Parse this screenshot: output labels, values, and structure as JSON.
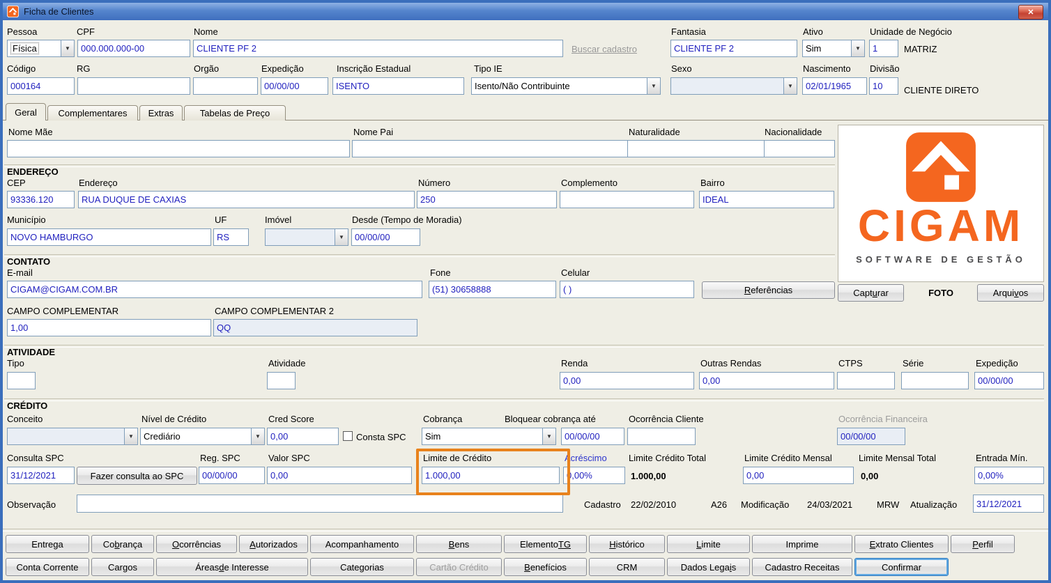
{
  "icons": {
    "close": "✕",
    "dropdown": "▼"
  },
  "window": {
    "title": "Ficha de Clientes"
  },
  "top": {
    "pessoa": {
      "label": "Pessoa",
      "value": "Física"
    },
    "cpf": {
      "label": "CPF",
      "value": "000.000.000-00"
    },
    "nome": {
      "label": "Nome",
      "value": "CLIENTE PF 2"
    },
    "buscar": "Buscar cadastro",
    "fantasia": {
      "label": "Fantasia",
      "value": "CLIENTE PF 2"
    },
    "ativo": {
      "label": "Ativo",
      "value": "Sim"
    },
    "unidade": {
      "label": "Unidade de Negócio",
      "value": "1",
      "desc": "MATRIZ"
    },
    "codigo": {
      "label": "Código",
      "value": "000164"
    },
    "rg": {
      "label": "RG",
      "value": ""
    },
    "orgao": {
      "label": "Orgão",
      "value": ""
    },
    "expedicao": {
      "label": "Expedição",
      "value": "00/00/00"
    },
    "inscricao": {
      "label": "Inscrição Estadual",
      "value": "ISENTO"
    },
    "tipo_ie": {
      "label": "Tipo IE",
      "value": "Isento/Não Contribuinte"
    },
    "sexo": {
      "label": "Sexo",
      "value": ""
    },
    "nascimento": {
      "label": "Nascimento",
      "value": "02/01/1965"
    },
    "divisao": {
      "label": "Divisão",
      "value": "10",
      "desc": "CLIENTE DIRETO"
    }
  },
  "tabs": {
    "geral": "Geral",
    "complementares": "Complementares",
    "extras": "Extras",
    "tabelas": "Tabelas de Preço"
  },
  "geral": {
    "nome_mae": {
      "label": "Nome Mãe",
      "value": ""
    },
    "nome_pai": {
      "label": "Nome Pai",
      "value": ""
    },
    "naturalidade": {
      "label": "Naturalidade",
      "value": ""
    },
    "nacionalidade": {
      "label": "Nacionalidade",
      "value": ""
    }
  },
  "logo": {
    "brand": "CIGAM",
    "tagline": "SOFTWARE DE GESTÃO",
    "capturar": "Capt&urar",
    "foto": "FOTO",
    "arquivos": "Arqui&vos"
  },
  "endereco": {
    "header": "ENDEREÇO",
    "cep": {
      "label": "CEP",
      "value": "93336.120"
    },
    "endereco": {
      "label": "Endereço",
      "value": "RUA DUQUE DE CAXIAS"
    },
    "numero": {
      "label": "Número",
      "value": "250"
    },
    "complemento": {
      "label": "Complemento",
      "value": ""
    },
    "bairro": {
      "label": "Bairro",
      "value": "IDEAL"
    },
    "municipio": {
      "label": "Município",
      "value": "NOVO HAMBURGO"
    },
    "uf": {
      "label": "UF",
      "value": "RS"
    },
    "imovel": {
      "label": "Imóvel",
      "value": ""
    },
    "desde": {
      "label": "Desde (Tempo de Moradia)",
      "value": "00/00/00"
    }
  },
  "contato": {
    "header": "CONTATO",
    "email": {
      "label": "E-mail",
      "value": "CIGAM@CIGAM.COM.BR"
    },
    "fone": {
      "label": "Fone",
      "value": "(51) 30658888"
    },
    "celular": {
      "label": "Celular",
      "value": "( )"
    },
    "referencias": "&Referências",
    "cc1": {
      "label": "CAMPO COMPLEMENTAR",
      "value": "1,00"
    },
    "cc2": {
      "label": "CAMPO COMPLEMENTAR 2",
      "value": "QQ"
    }
  },
  "atividade": {
    "header": "ATIVIDADE",
    "tipo": {
      "label": "Tipo",
      "value": ""
    },
    "atividade": {
      "label": "Atividade",
      "value": ""
    },
    "renda": {
      "label": "Renda",
      "value": "0,00"
    },
    "outras": {
      "label": "Outras Rendas",
      "value": "0,00"
    },
    "ctps": {
      "label": "CTPS",
      "value": ""
    },
    "serie": {
      "label": "Série",
      "value": ""
    },
    "expedicao": {
      "label": "Expedição",
      "value": "00/00/00"
    }
  },
  "credito": {
    "header": "CRÉDITO",
    "conceito": {
      "label": "Conceito",
      "value": ""
    },
    "nivel": {
      "label": "Nível de Crédito",
      "value": "Crediário"
    },
    "cred_score": {
      "label": "Cred Score",
      "value": "0,00"
    },
    "consta_spc": "Consta SPC",
    "cobranca": {
      "label": "Cobrança",
      "value": "Sim"
    },
    "bloquear": {
      "label": "Bloquear cobrança até",
      "value": "00/00/00"
    },
    "ocorrencia_cliente": {
      "label": "Ocorrência Cliente",
      "value": ""
    },
    "ocorrencia_financeira": {
      "label": "Ocorrência Financeira",
      "value": "00/00/00"
    },
    "consulta_spc": {
      "label": "Consulta SPC",
      "value": "31/12/2021"
    },
    "fazer_consulta": "Fazer consulta ao SPC",
    "reg_spc": {
      "label": "Reg. SPC",
      "value": "00/00/00"
    },
    "valor_spc": {
      "label": "Valor SPC",
      "value": "0,00"
    },
    "limite_credito": {
      "label": "Limite de Crédito",
      "value": "1.000,00"
    },
    "acrescimo": {
      "label": "Acréscimo",
      "value": "0,00%"
    },
    "limite_total": {
      "label": "Limite Crédito Total",
      "value": "1.000,00"
    },
    "limite_mensal": {
      "label": "Limite Crédito Mensal",
      "value": "0,00"
    },
    "limite_mensal_total": {
      "label": "Limite Mensal Total",
      "value": "0,00"
    },
    "entrada_min": {
      "label": "Entrada Mín.",
      "value": "0,00%"
    }
  },
  "rodape": {
    "observacao": {
      "label": "Observação",
      "value": ""
    },
    "cadastro_label": "Cadastro",
    "cadastro_data": "22/02/2010",
    "cadastro_user": "A26",
    "modificacao_label": "Modificação",
    "modificacao_data": "24/03/2021",
    "modificacao_user": "MRW",
    "atualizacao_label": "Atualização",
    "atualizacao_value": "31/12/2021"
  },
  "botoes": {
    "row1": [
      "Entrega",
      "Co&brança",
      "&Ocorrências",
      "&Autorizados",
      "Acompanhamento",
      "&Bens",
      "Elemento &TG&",
      "&Histórico",
      "&Limite",
      "Imprime",
      "&Extrato Clientes",
      "&Perfil"
    ],
    "row2": [
      "Conta Corrente",
      "Cargos",
      "Áreas &de Interesse",
      "Categorias",
      "Cartão Crédito",
      "&Benefícios",
      "CRM",
      "Dados Lega&is",
      "Cadastro Receitas",
      "Confirmar"
    ]
  }
}
